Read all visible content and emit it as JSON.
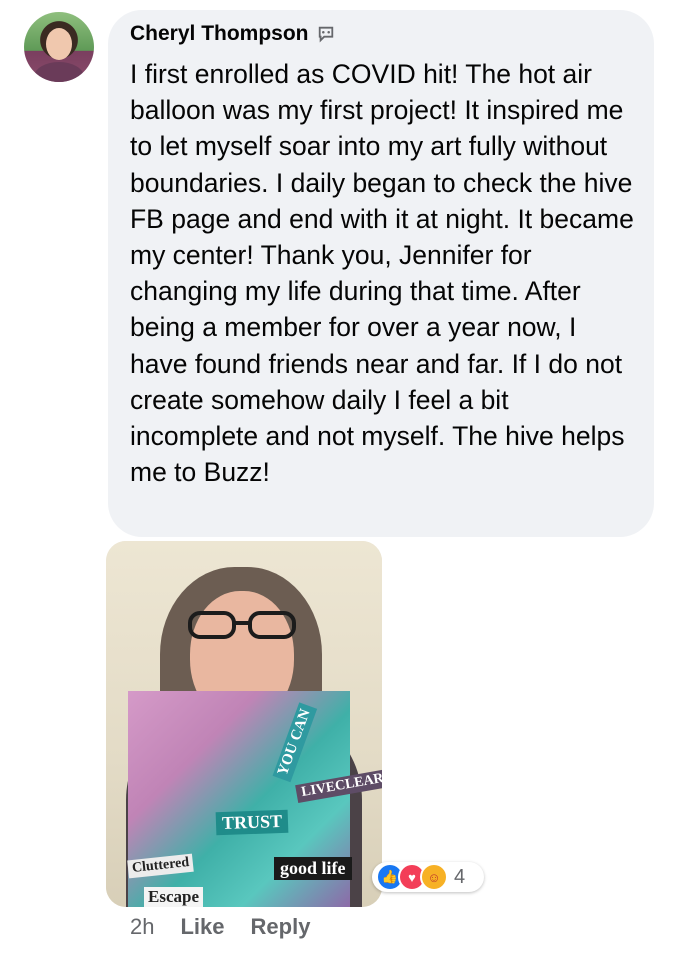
{
  "comment": {
    "author": "Cheryl Thompson",
    "text": "I first enrolled as COVID hit! The hot air balloon was my first project! It inspired me to let myself soar into my art fully without boundaries. I daily began to check the hive FB page and end with it at night. It became my center! Thank you, Jennifer for changing my life during that time. After being a member for over a year now, I have found friends near and far. If I do not create somehow daily I feel a bit incomplete and not myself. The hive helps me to Buzz!",
    "author_badge_icon": "chat-bubble-icon"
  },
  "photo": {
    "collage_words": [
      "TRUST",
      "Cluttered",
      "Escape",
      "good life",
      "LIVECLEAR",
      "YOU CAN"
    ]
  },
  "reactions": {
    "icons": [
      "like-icon",
      "love-icon",
      "care-icon"
    ],
    "count": "4",
    "colors": {
      "like": "#1877f2",
      "love": "#f33e58",
      "care": "#f7b125"
    }
  },
  "meta": {
    "time": "2h",
    "like_label": "Like",
    "reply_label": "Reply"
  }
}
